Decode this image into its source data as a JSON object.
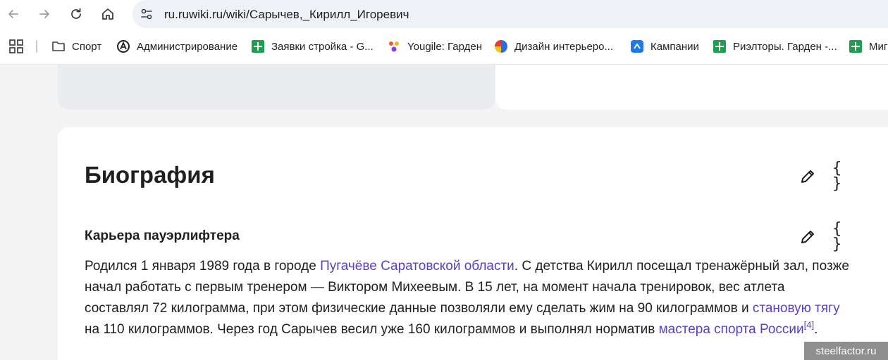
{
  "browser": {
    "url": "ru.ruwiki.ru/wiki/Сарычев,_Кирилл_Игоревич",
    "icons": [
      "back-arrow-icon",
      "forward-arrow-icon",
      "reload-icon",
      "home-icon",
      "site-settings-icon"
    ]
  },
  "bookmarks": {
    "items": [
      {
        "label": "Спорт",
        "icon": "folder-icon"
      },
      {
        "label": "Администрирование",
        "icon": "admin-logo-icon"
      },
      {
        "label": "Заявки стройка - G...",
        "icon": "sheets-icon"
      },
      {
        "label": "Yougile: Гарден",
        "icon": "yougile-icon"
      },
      {
        "label": "Дизайн интерьеро...",
        "icon": "circle-logo-icon"
      },
      {
        "label": "Кампании",
        "icon": "campaigns-icon"
      },
      {
        "label": "Риэлторы. Гарден -...",
        "icon": "sheets-icon"
      },
      {
        "label": "Миг",
        "icon": "sheets-icon"
      }
    ]
  },
  "article": {
    "section_title": "Биография",
    "subsection_title": "Карьера пауэрлифтера",
    "source_label": "{ }",
    "paragraph": {
      "t1": "Родился 1 января 1989 года в городе ",
      "link1": "Пугачёве Саратовской области",
      "t2": ". С детства Кирилл посещал тренажёрный зал, позже начал работать с первым тренером — Виктором Михеевым. В 15 лет, на момент начала тренировок, вес атлета составлял 72 килограмма, при этом физические данные позволяли ему сделать жим на 90 килограммов и ",
      "link2": "становую тягу",
      "t3": " на 110 килограммов. Через год Сарычев весил уже 160 килограммов и выполнял норматив ",
      "link3": "мастера спорта России",
      "ref": "[4]",
      "t4": "."
    }
  },
  "watermark": "steelfactor.ru",
  "colors": {
    "link": "#5b3fc4",
    "sheets": "#1e9e4f",
    "card_grey": "#ebecef"
  }
}
